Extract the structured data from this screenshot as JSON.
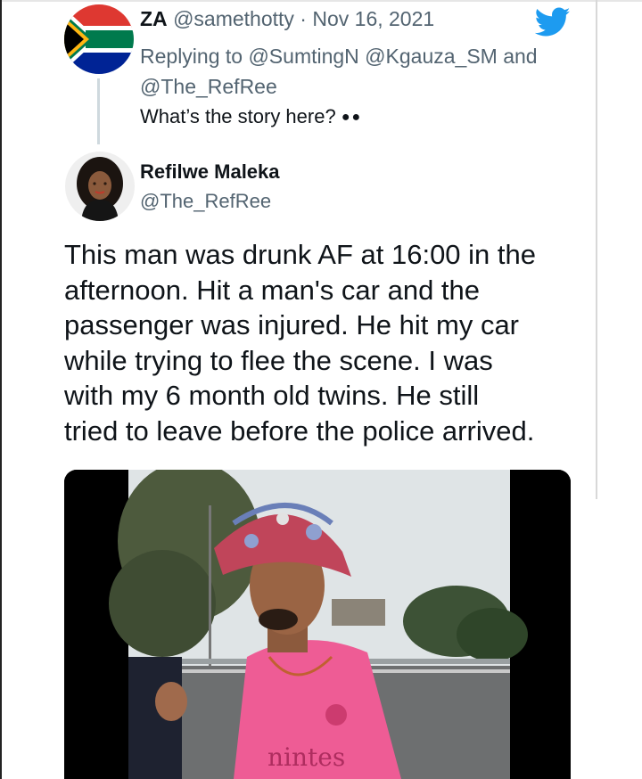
{
  "parent_tweet": {
    "display_name": "ZA",
    "handle": "@samethotty",
    "separator": "·",
    "date": "Nov 16, 2021",
    "replying_to": "Replying to @SumtingN @Kgauza_SM and @The_RefRee",
    "text": "What’s the story here?",
    "emoji_icon": "eyes-icon",
    "avatar_icon": "south-africa-flag-icon",
    "platform_icon": "twitter-bird-icon",
    "colors": {
      "twitter_blue": "#1d9bf0",
      "muted": "#536471",
      "thread_line": "#cfd9de"
    }
  },
  "reply_tweet": {
    "display_name": "Refilwe Maleka",
    "handle": "@The_RefRee",
    "lines": [
      "This man was drunk AF at 16:00 in the",
      "afternoon. Hit a man's car and the",
      "passenger was injured. He hit my car",
      "while trying to flee the scene. I was",
      "with my 6 month old twins. He still",
      "tried to leave before the police arrived."
    ]
  },
  "media": {
    "shirt_text": "nintes",
    "description_icon": "video-thumbnail"
  }
}
